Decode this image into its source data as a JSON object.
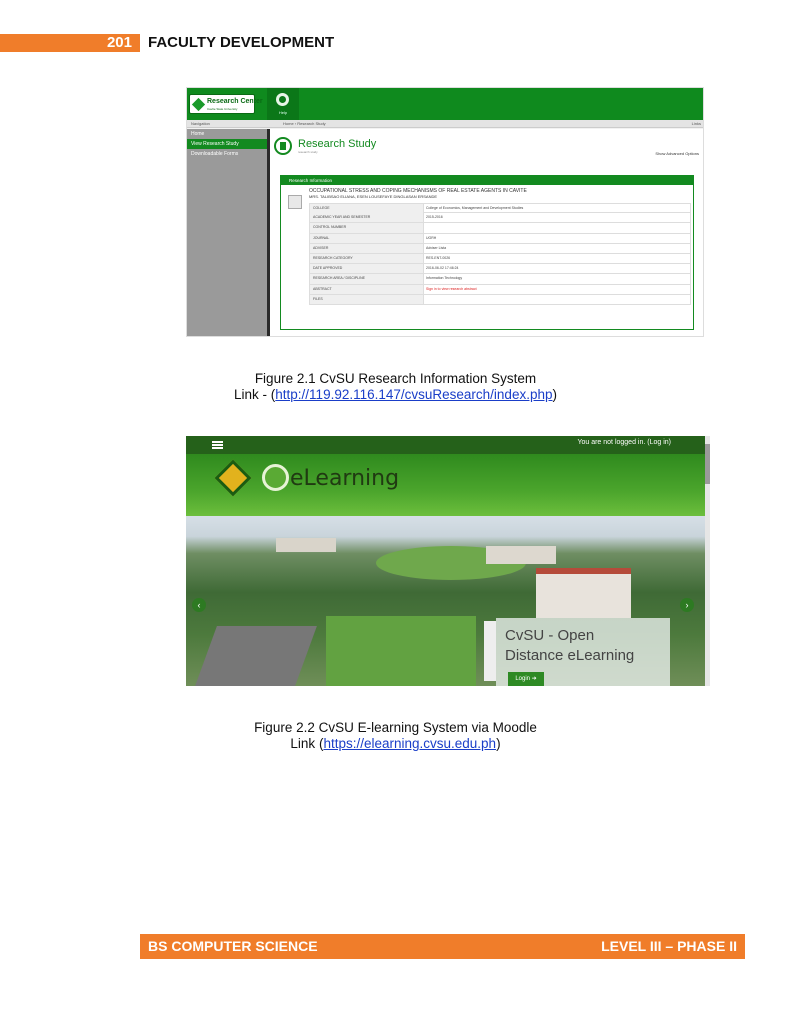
{
  "header": {
    "page_number": "201",
    "title": "FACULTY DEVELOPMENT"
  },
  "figure1": {
    "logo_text": "Research Center",
    "logo_subtext": "Cavite State University",
    "nav_icon_label": "Help",
    "subbar_left": "Navigation",
    "subbar_crumb": "Home › Research Study",
    "subbar_right": "Links",
    "sidebar": [
      {
        "label": "Home",
        "active": false
      },
      {
        "label": "View Research Study",
        "active": true
      },
      {
        "label": "Downloadable Forms",
        "active": false
      }
    ],
    "page_title": "Research Study",
    "page_subtitle": "research study",
    "advanced_options": "Show Advanced Options",
    "panel_heading": "Research Information",
    "study_title": "OCCUPATIONAL STRESS AND COPING MECHANISMS OF REAL ESTATE AGENTS IN CAVITE",
    "authors": "MRS. TALIBSAO ELIANA, ESEN LOUSEFAYE DINGLASAN ERSANDE",
    "rows": [
      {
        "label": "COLLEGE",
        "value": "College of Economics, Management and Development Studies"
      },
      {
        "label": "ACADEMIC YEAR AND SEMESTER",
        "value": "2015-2016"
      },
      {
        "label": "CONTROL NUMBER",
        "value": ""
      },
      {
        "label": "JOURNAL",
        "value": "UGRH"
      },
      {
        "label": "ADVISER",
        "value": "Adviser Lista"
      },
      {
        "label": "RESEARCH CATEGORY",
        "value": "RES-ENT-0026"
      },
      {
        "label": "DATE APPROVED",
        "value": "2016-06-02 17:46:24"
      },
      {
        "label": "RESEARCH AREA / DISCIPLINE",
        "value": "Information Technology"
      },
      {
        "label": "ABSTRACT",
        "value": "Sign in to view research abstract",
        "red": true
      },
      {
        "label": "FILES",
        "value": ""
      }
    ]
  },
  "caption1": {
    "line1": "Figure 2.1 CvSU Research Information System",
    "prefix": "Link - (",
    "link": "http://119.92.116.147/cvsuResearch/index.php",
    "suffix": ")"
  },
  "figure2": {
    "login_status": "You are not logged in. (Log in)",
    "wordmark": "eLearning",
    "overlay_line1": "CvSU - Open",
    "overlay_line2": "Distance eLearning",
    "login_button": "Login ➜",
    "prev_arrow": "‹",
    "next_arrow": "›"
  },
  "caption2": {
    "line1": "Figure 2.2 CvSU E-learning System via Moodle",
    "prefix": "Link (",
    "link": "https://elearning.cvsu.edu.ph",
    "suffix": ")"
  },
  "footer": {
    "left": "BS COMPUTER SCIENCE",
    "right": "LEVEL III – PHASE II"
  },
  "colors": {
    "accent_orange": "#f07d2a",
    "research_green": "#138a20",
    "elearning_green": "#25611a",
    "link_blue": "#1a3ec8"
  }
}
